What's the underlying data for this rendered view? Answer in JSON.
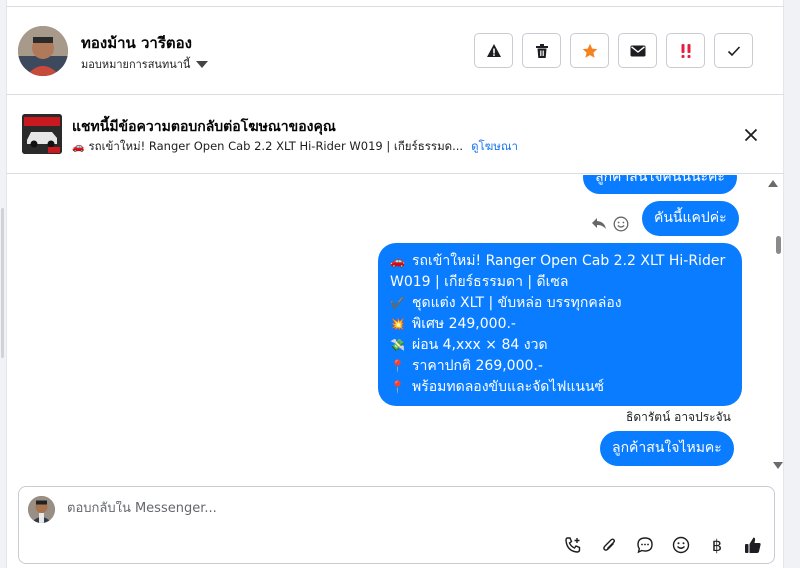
{
  "header": {
    "contact_name": "ทองม้าน วารีตอง",
    "assign_label": "มอบหมายการสนทนานี้"
  },
  "ad": {
    "title": "แชทนี้มีข้อความตอบกลับต่อโฆษณาของคุณ",
    "subtitle": "รถเข้าใหม่! Ranger Open Cab 2.2 XLT Hi-Rider W019 | เกียร์ธรรมด...",
    "link": "ดูโฆษณา"
  },
  "messages": {
    "m1": "ลูกค้าสนใจคันนี้นะคะ",
    "m2": "คันนี้แคปค่ะ",
    "m3_lines": [
      "รถเข้าใหม่! Ranger Open Cab 2.2 XLT Hi-Rider W019 | เกียร์ธรรมดา | ดีเซล",
      "ชุดแต่ง XLT | ขับหล่อ บรรทุกคล่อง",
      "พิเศษ 249,000.-",
      "ผ่อน 4,xxx × 84 งวด",
      "ราคาปกติ 269,000.-",
      "พร้อมทดลองขับและจัดไฟแนนซ์"
    ],
    "m3_emojis": [
      "🚗",
      "✔️",
      "💥",
      "💸",
      "📍",
      "📍"
    ],
    "sender_name": "ธิดารัตน์ อาจประจัน",
    "m4": "ลูกค้าสนใจไหมคะ"
  },
  "composer": {
    "placeholder": "ตอบกลับใน Messenger..."
  },
  "colors": {
    "bubble": "#0a7cff",
    "link": "#1877f2",
    "star": "#f5821f",
    "alert": "#e41e3f"
  },
  "icons": [
    "warning-icon",
    "trash-icon",
    "star-icon",
    "mail-icon",
    "double-exclamation-icon",
    "check-icon",
    "close-icon",
    "reply-icon",
    "emoji-icon",
    "call-add-icon",
    "attachment-icon",
    "chat-bubble-icon",
    "emoji-icon",
    "baht-icon",
    "thumbs-up-icon"
  ]
}
